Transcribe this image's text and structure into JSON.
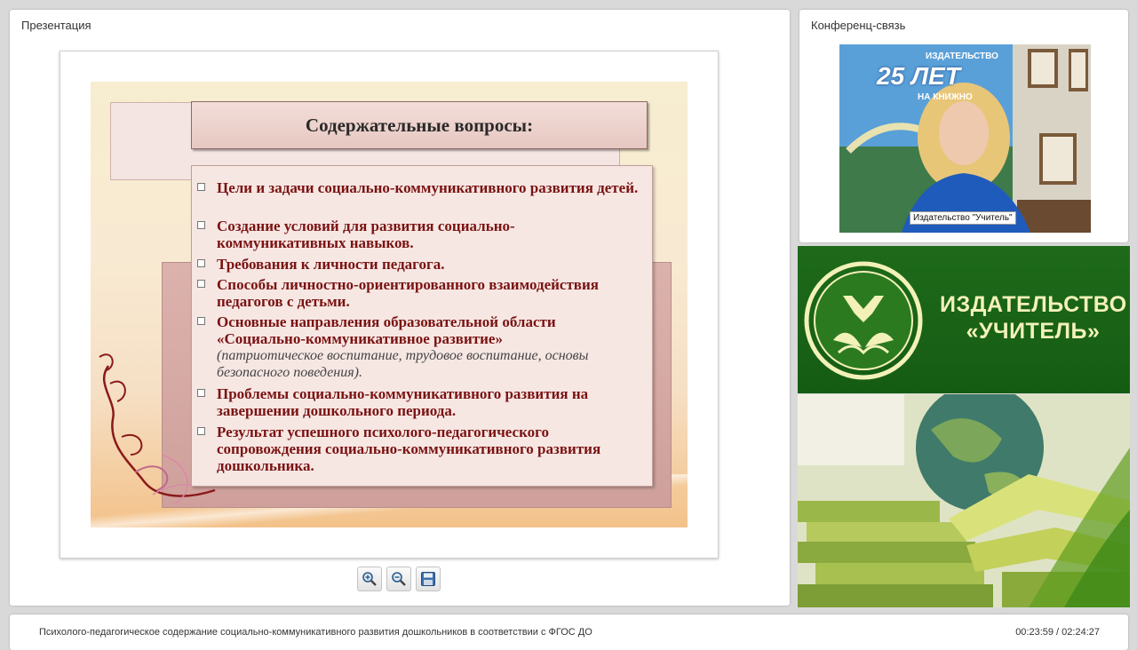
{
  "presentation_panel": {
    "title": "Презентация"
  },
  "conference_panel": {
    "title": "Конференц-связь",
    "video_label": "Издательство \"Учитель\"",
    "banner_top": "ИЗДАТЕЛЬСТВО",
    "banner_number": "25 ЛЕТ",
    "banner_sub": "НА КНИЖНО"
  },
  "slide": {
    "title": "Содержательные вопросы:",
    "items": [
      {
        "text": "Цели и задачи социально-коммуникативного развития детей."
      },
      {
        "text": "Создание  условий для развития социально-коммуникативных навыков."
      },
      {
        "text": "Требования к личности педагога."
      },
      {
        "text": "Способы личностно-ориентированного взаимодействия педагогов с детьми."
      },
      {
        "text": "Основные направления образовательной области «Социально-коммуникативное развитие»",
        "note": "(патриотическое воспитание, трудовое воспитание, основы безопасного поведения)."
      },
      {
        "text": "Проблемы социально-коммуникативного развития на завершении дошкольного периода."
      },
      {
        "text": "Результат  успешного  психолого-педагогического сопровождения социально-коммуникативного развития дошкольника."
      }
    ]
  },
  "toolbar": {
    "icons": [
      "zoom-in-icon",
      "zoom-out-icon",
      "save-icon"
    ]
  },
  "brand": {
    "line1": "ИЗДАТЕЛЬСТВО",
    "line2": "«УЧИТЕЛЬ»",
    "color": "#1e6a1a",
    "text_color": "#f2f1b8"
  },
  "footer": {
    "title": "Психолого-педагогическое содержание социально-коммуникативного развития дошкольников в соответствии с ФГОС ДО",
    "time": "00:23:59 / 02:24:27"
  }
}
